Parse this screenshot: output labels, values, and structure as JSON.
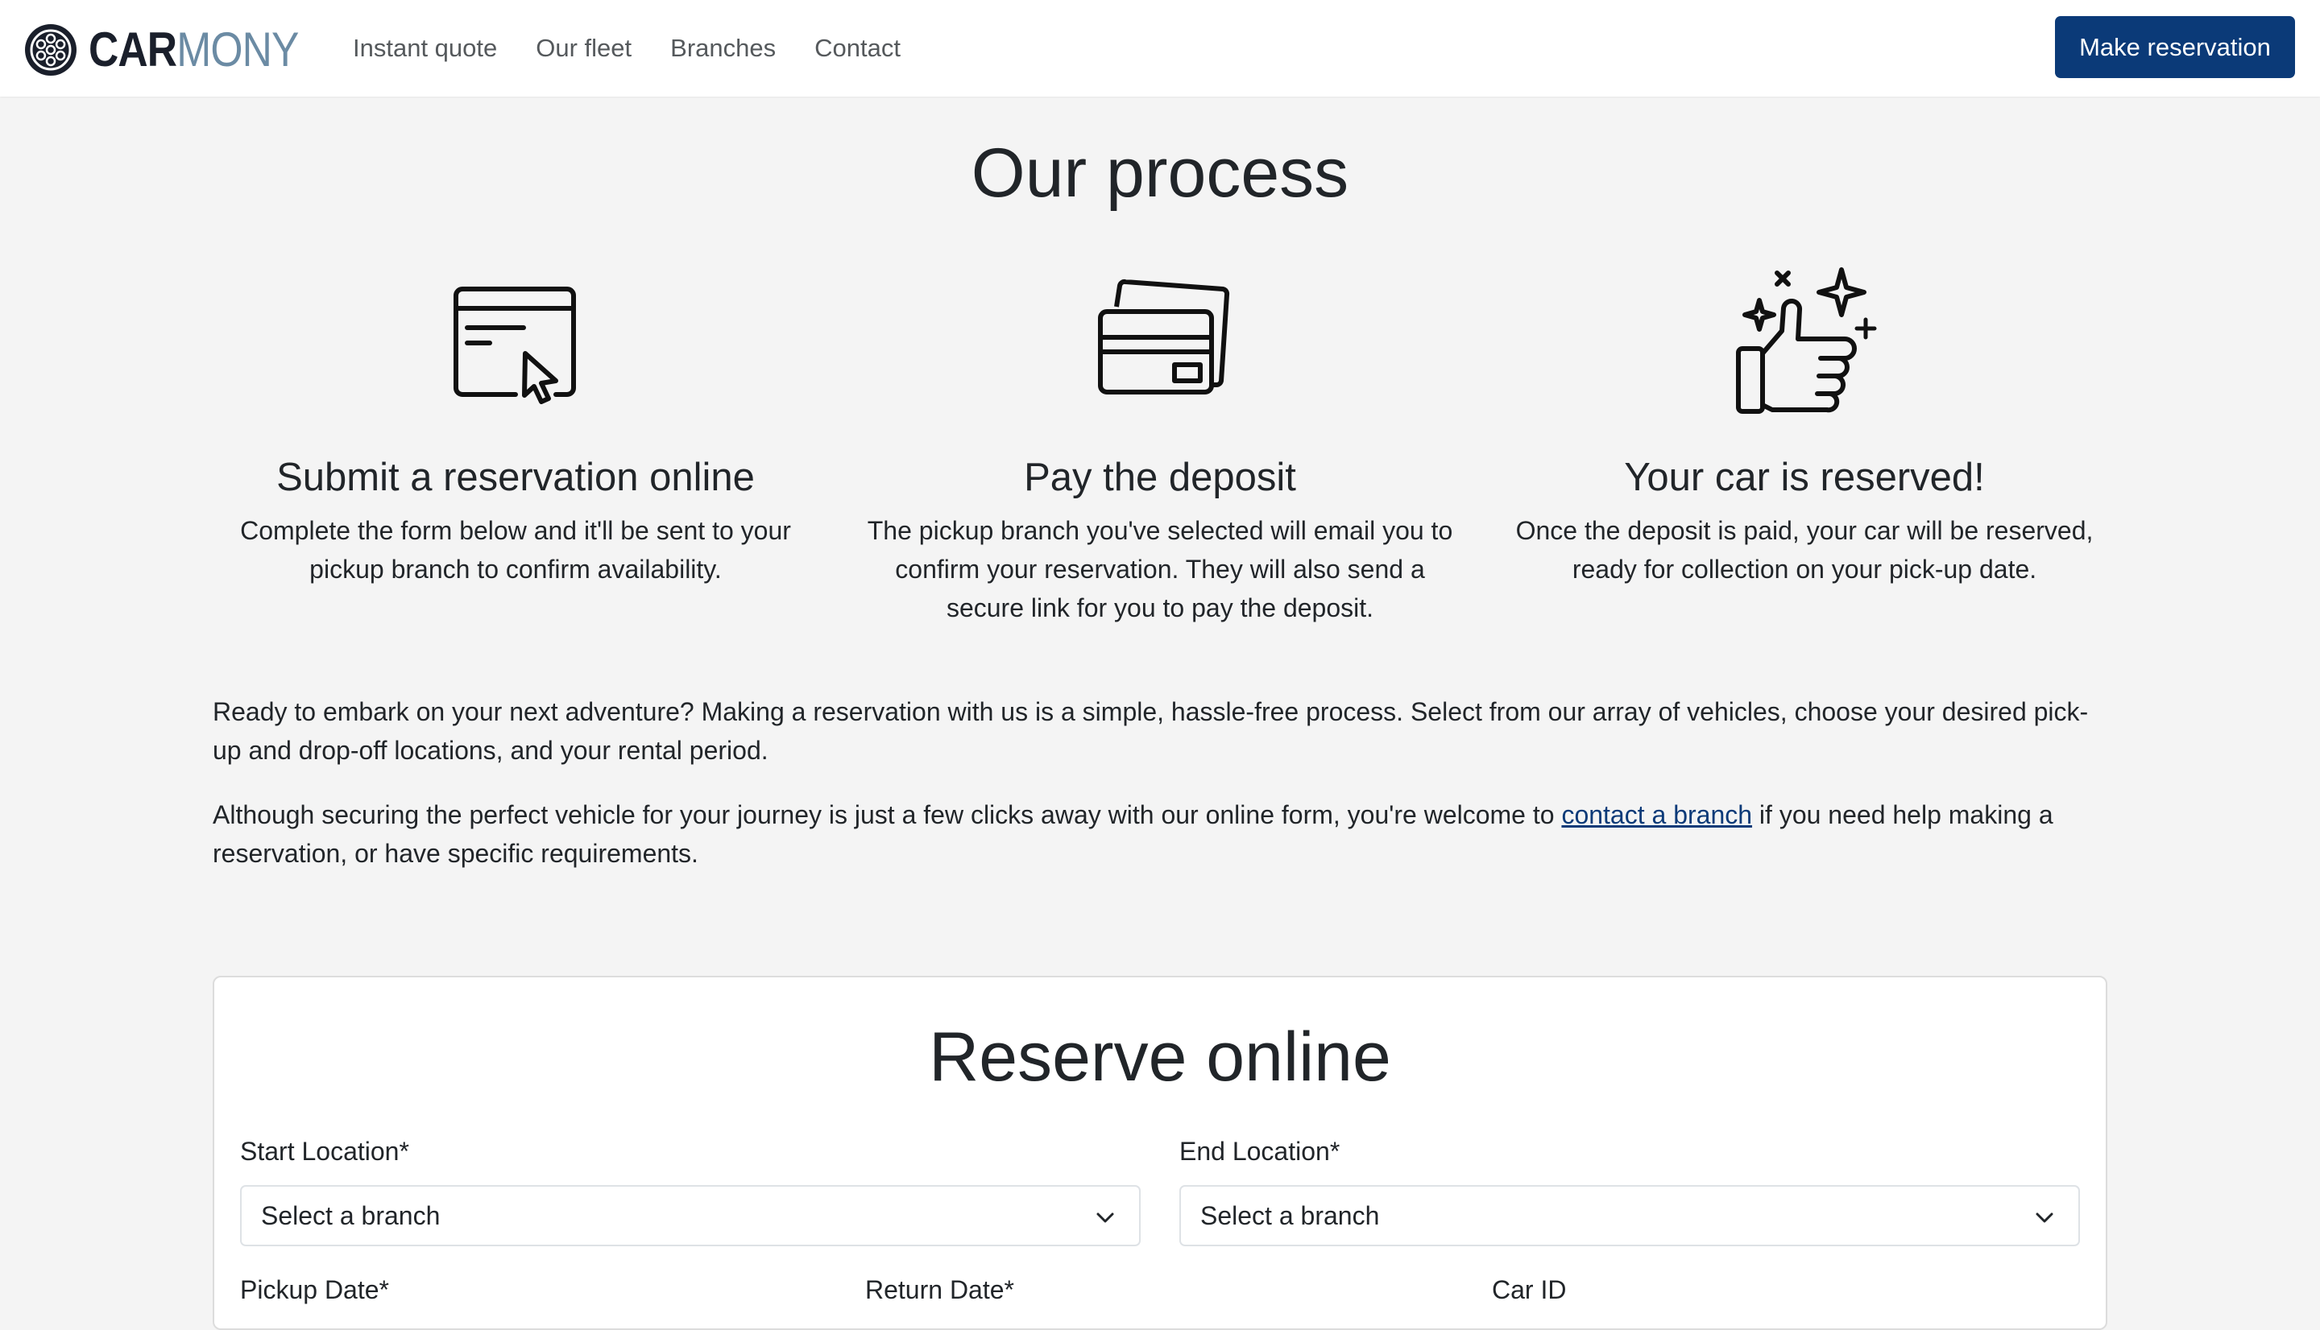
{
  "brand": {
    "part1": "CAR",
    "part2": "MONY"
  },
  "nav": {
    "links": [
      "Instant quote",
      "Our fleet",
      "Branches",
      "Contact"
    ],
    "cta": "Make reservation"
  },
  "process": {
    "title": "Our process",
    "steps": [
      {
        "icon": "browser-cursor-icon",
        "title": "Submit a reservation online",
        "text": "Complete the form below and it'll be sent to your pickup branch to confirm availability."
      },
      {
        "icon": "credit-cards-icon",
        "title": "Pay the deposit",
        "text": "The pickup branch you've selected will email you to confirm your reservation. They will also send a secure link for you to pay the deposit."
      },
      {
        "icon": "thumbs-up-sparkle-icon",
        "title": "Your car is reserved!",
        "text": "Once the deposit is paid, your car will be reserved, ready for collection on your pick-up date."
      }
    ]
  },
  "intro": {
    "p1": "Ready to embark on your next adventure? Making a reservation with us is a simple, hassle-free process. Select from our array of vehicles, choose your desired pick-up and drop-off locations, and your rental period.",
    "p2_before": "Although securing the perfect vehicle for your journey is just a few clicks away with our online form, you're welcome to ",
    "p2_link": "contact a branch",
    "p2_after": " if you need help making a reservation, or have specific requirements."
  },
  "reserve": {
    "title": "Reserve online",
    "start_label": "Start Location*",
    "start_value": "Select a branch",
    "end_label": "End Location*",
    "end_value": "Select a branch",
    "pickup_label": "Pickup Date*",
    "return_label": "Return Date*",
    "carid_label": "Car ID"
  },
  "colors": {
    "primary": "#0b3a78",
    "brand_accent": "#6b8ba4",
    "page_bg": "#f4f4f4"
  }
}
